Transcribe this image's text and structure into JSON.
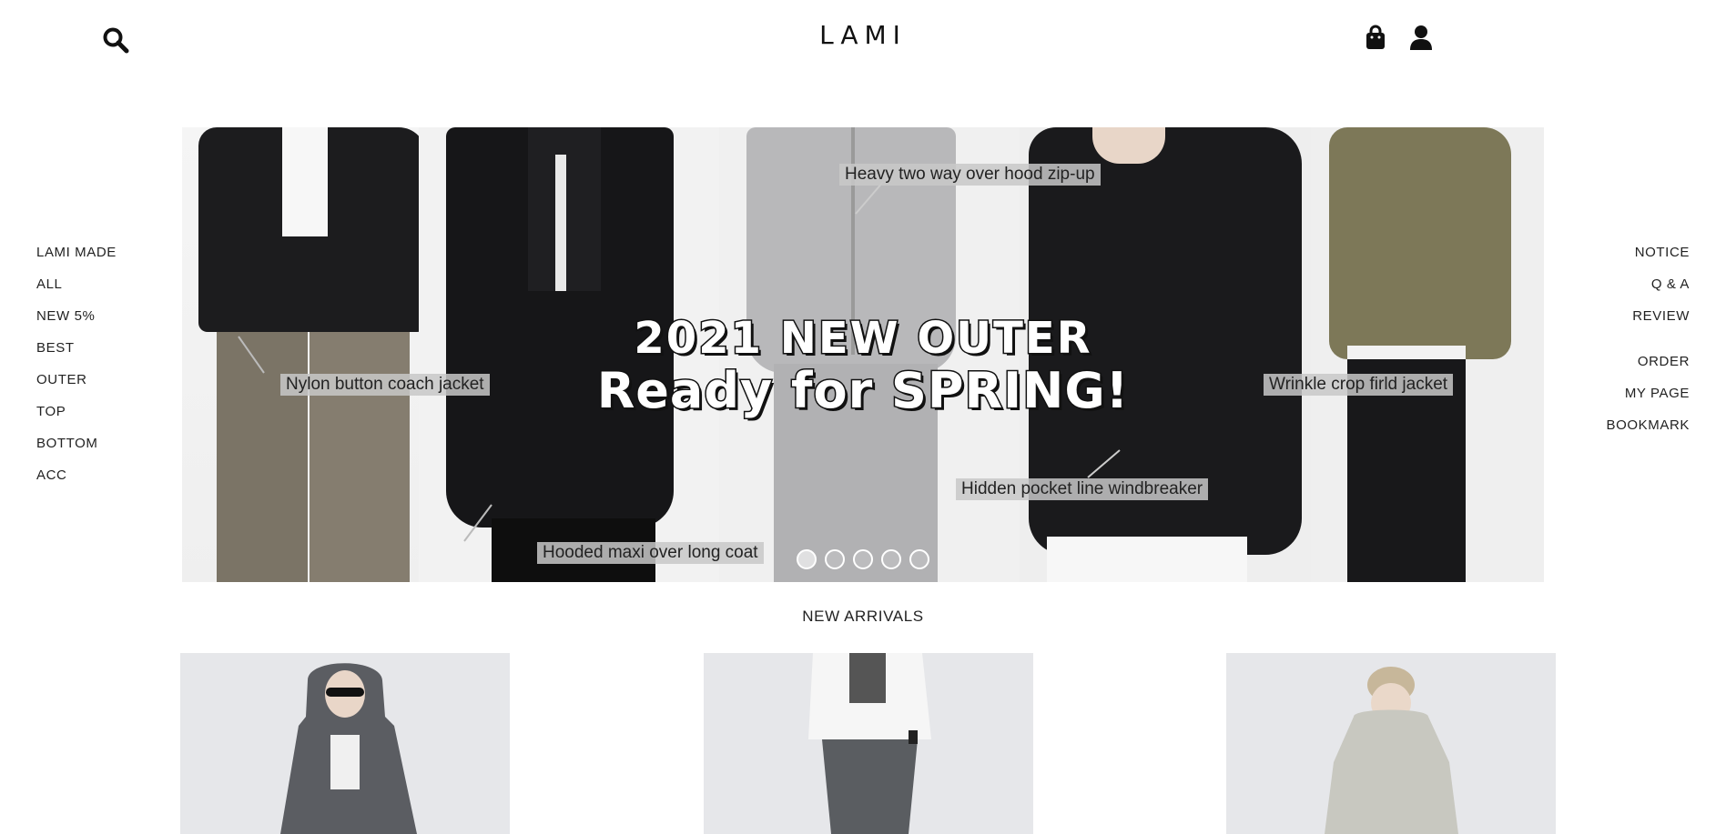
{
  "header": {
    "logo": "LAMI",
    "icons": [
      "search-icon",
      "shopping-bag-icon",
      "user-icon"
    ]
  },
  "sidebar_left": {
    "items": [
      {
        "label": "LAMI MADE"
      },
      {
        "label": "ALL"
      },
      {
        "label": "NEW 5%"
      },
      {
        "label": "BEST"
      },
      {
        "label": "OUTER"
      },
      {
        "label": "TOP"
      },
      {
        "label": "BOTTOM"
      },
      {
        "label": "ACC"
      }
    ]
  },
  "sidebar_right": {
    "group1": [
      {
        "label": "NOTICE"
      },
      {
        "label": "Q & A"
      },
      {
        "label": "REVIEW"
      }
    ],
    "group2": [
      {
        "label": "ORDER"
      },
      {
        "label": "MY PAGE"
      },
      {
        "label": "BOOKMARK"
      }
    ]
  },
  "hero": {
    "title_line1": "2021 NEW OUTER",
    "title_line2": "Ready for SPRING!",
    "labels": {
      "coach_jacket": "Nylon button coach jacket",
      "long_coat": "Hooded maxi over long coat",
      "zip_up": "Heavy two way over hood zip-up",
      "windbreaker": "Hidden pocket line windbreaker",
      "crop_jacket": "Wrinkle crop firld jacket"
    },
    "slides": 5,
    "active_slide": 1
  },
  "new_arrivals": {
    "title": "NEW ARRIVALS",
    "products": 3
  },
  "colors": {
    "text": "#111111",
    "hero_background": "#f0f0f0",
    "product_background": "#e9eaec"
  }
}
